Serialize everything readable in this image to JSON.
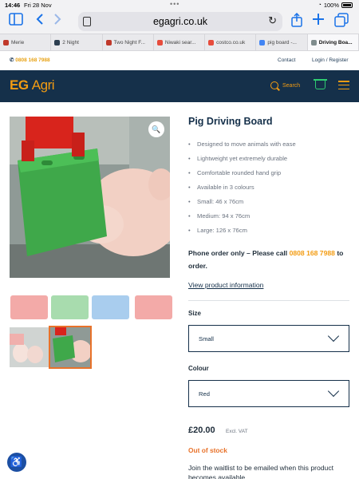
{
  "status_bar": {
    "time": "14:46",
    "date": "Fri 28 Nov",
    "battery": "100%"
  },
  "browser": {
    "url": "egagri.co.uk",
    "tabs": [
      {
        "label": "Merie",
        "color": "#c0392b"
      },
      {
        "label": "2 Night",
        "color": "#2c3e50"
      },
      {
        "label": "Two Night F...",
        "color": "#c0392b"
      },
      {
        "label": "Niwaki sear...",
        "color": "#e74c3c"
      },
      {
        "label": "costco.co.uk",
        "color": "#e74c3c"
      },
      {
        "label": "pig board -...",
        "color": "#4285f4"
      },
      {
        "label": "Driving Boa...",
        "color": "#7f8c8d",
        "active": true
      }
    ]
  },
  "site": {
    "phone": "0808 168 7988",
    "contact": "Contact",
    "login": "Login / Register",
    "logo_eg": "EG",
    "logo_agri": "Agri",
    "search_label": "Search"
  },
  "product": {
    "title": "Pig Driving Board",
    "features": [
      "Designed to move animals with ease",
      "Lightweight yet extremely durable",
      "Comfortable rounded hand grip",
      "Available in 3 colours",
      "Small: 46 x 76cm",
      "Medium: 94 x 76cm",
      "Large: 126 x 76cm"
    ],
    "order_prefix": "Phone order only – Please call ",
    "order_phone": "0808 168 7988",
    "order_suffix": " to order.",
    "view_info": "View product information",
    "size_label": "Size",
    "size_value": "Small",
    "colour_label": "Colour",
    "colour_value": "Red",
    "price": "£20.00",
    "vat": "Excl. VAT",
    "stock": "Out of stock",
    "waitlist": "Join the waitlist to be emailed when this product becomes available"
  },
  "thumbnails": [
    {
      "color": "#f3aaa8"
    },
    {
      "color": "#a8dcae"
    },
    {
      "color": "#a9cdee"
    },
    {
      "color": "#f3aaa8"
    }
  ]
}
